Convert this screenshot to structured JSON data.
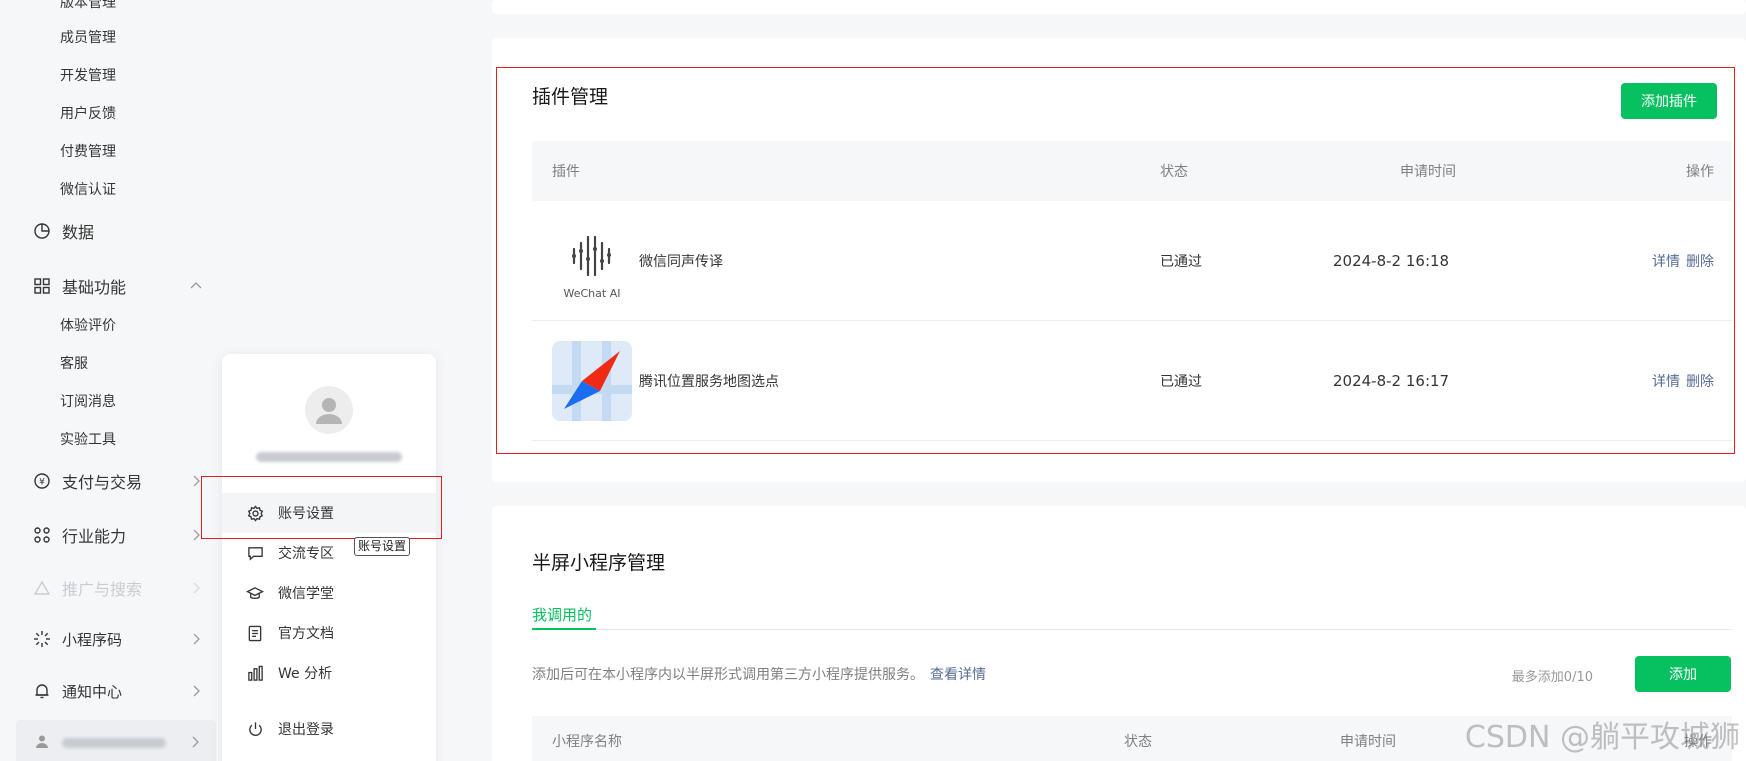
{
  "sidebar": {
    "top_cut": "版本管理",
    "sub_items": [
      "成员管理",
      "开发管理",
      "用户反馈",
      "付费管理",
      "微信认证"
    ],
    "data_label": "数据",
    "basic_label": "基础功能",
    "basic_items": [
      "体验评价",
      "客服",
      "订阅消息",
      "实验工具"
    ],
    "pay_label": "支付与交易",
    "industry_label": "行业能力",
    "promo_label": "推广与搜索",
    "qrcode_label": "小程序码",
    "notify_label": "通知中心"
  },
  "account_popup": {
    "menu": [
      "账号设置",
      "交流专区",
      "微信学堂",
      "官方文档",
      "We 分析",
      "退出登录"
    ],
    "tooltip": "账号设置"
  },
  "plugin_card": {
    "title": "插件管理",
    "add_button": "添加插件",
    "columns": [
      "插件",
      "状态",
      "申请时间",
      "操作"
    ],
    "rows": [
      {
        "name": "微信同声传译",
        "status": "已通过",
        "time": "2024-8-2 16:18",
        "logo_text": "WeChat AI",
        "actions": [
          "详情",
          "删除"
        ]
      },
      {
        "name": "腾讯位置服务地图选点",
        "status": "已通过",
        "time": "2024-8-2 16:17",
        "actions": [
          "详情",
          "删除"
        ]
      }
    ]
  },
  "half_card": {
    "title": "半屏小程序管理",
    "tab": "我调用的",
    "description": "添加后可在本小程序内以半屏形式调用第三方小程序提供服务。",
    "link": "查看详情",
    "limit": "最多添加0/10",
    "add_button": "添加",
    "columns": [
      "小程序名称",
      "状态",
      "申请时间",
      "操作"
    ]
  },
  "watermark": "CSDN @躺平攻城狮",
  "colors": {
    "accent": "#07c160",
    "link": "#576b95",
    "highlight": "#e02020"
  }
}
